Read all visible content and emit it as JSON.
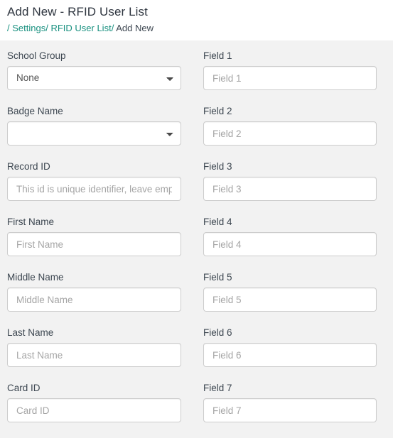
{
  "header": {
    "title": "Add New - RFID User List",
    "breadcrumb": {
      "sep": "/",
      "items": [
        {
          "label": "Settings",
          "link": true
        },
        {
          "label": "RFID User List",
          "link": true
        },
        {
          "label": "Add New",
          "link": false
        }
      ]
    }
  },
  "colors": {
    "page_background": "#f2f2f2",
    "header_background": "#ffffff",
    "link": "#18907f",
    "text": "#3c4650",
    "input_border": "#cccccc",
    "placeholder": "#a5a5a5"
  },
  "form": {
    "left_column": [
      {
        "name": "school-group",
        "label": "School Group",
        "type": "select",
        "value": "None",
        "options": [
          "None"
        ]
      },
      {
        "name": "badge-name",
        "label": "Badge Name",
        "type": "select",
        "value": "",
        "options": [
          ""
        ]
      },
      {
        "name": "record-id",
        "label": "Record ID",
        "type": "text",
        "value": "",
        "placeholder": "This id is unique identifier, leave empty for new record"
      },
      {
        "name": "first-name",
        "label": "First Name",
        "type": "text",
        "value": "",
        "placeholder": "First Name"
      },
      {
        "name": "middle-name",
        "label": "Middle Name",
        "type": "text",
        "value": "",
        "placeholder": "Middle Name"
      },
      {
        "name": "last-name",
        "label": "Last Name",
        "type": "text",
        "value": "",
        "placeholder": "Last Name"
      },
      {
        "name": "card-id",
        "label": "Card ID",
        "type": "text",
        "value": "",
        "placeholder": "Card ID"
      }
    ],
    "right_column": [
      {
        "name": "field-1",
        "label": "Field 1",
        "type": "text",
        "value": "",
        "placeholder": "Field 1"
      },
      {
        "name": "field-2",
        "label": "Field 2",
        "type": "text",
        "value": "",
        "placeholder": "Field 2"
      },
      {
        "name": "field-3",
        "label": "Field 3",
        "type": "text",
        "value": "",
        "placeholder": "Field 3"
      },
      {
        "name": "field-4",
        "label": "Field 4",
        "type": "text",
        "value": "",
        "placeholder": "Field 4"
      },
      {
        "name": "field-5",
        "label": "Field 5",
        "type": "text",
        "value": "",
        "placeholder": "Field 5"
      },
      {
        "name": "field-6",
        "label": "Field 6",
        "type": "text",
        "value": "",
        "placeholder": "Field 6"
      },
      {
        "name": "field-7",
        "label": "Field 7",
        "type": "text",
        "value": "",
        "placeholder": "Field 7"
      }
    ]
  }
}
